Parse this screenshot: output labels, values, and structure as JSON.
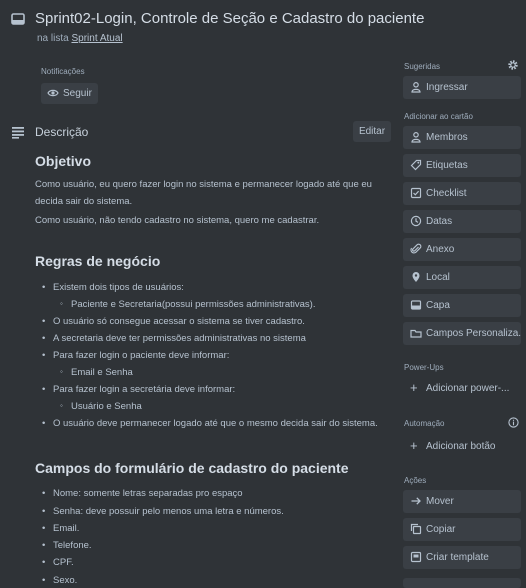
{
  "card": {
    "title": "Sprint02-Login, Controle de Seção e Cadastro do paciente",
    "list_prefix": "na lista",
    "list_name": "Sprint Atual"
  },
  "notifications": {
    "label": "Notificações",
    "follow": "Seguir"
  },
  "description": {
    "label": "Descrição",
    "edit": "Editar",
    "objective_title": "Objetivo",
    "objective_p1": "Como usuário, eu quero fazer login no sistema e permanecer logado até que eu decida sair do sistema.",
    "objective_p2": "Como usuário, não tendo cadastro no sistema, quero me cadastrar.",
    "rules_title": "Regras de negócio",
    "rules": [
      {
        "level": 1,
        "text": "Existem dois tipos de usuários:"
      },
      {
        "level": 2,
        "text": "Paciente e Secretaria(possui permissões administrativas)."
      },
      {
        "level": 1,
        "text": "O usuário só consegue acessar o sistema se tiver cadastro."
      },
      {
        "level": 1,
        "text": "A secretaria deve ter permissões administrativas no sistema"
      },
      {
        "level": 1,
        "text": "Para fazer login o paciente deve informar:"
      },
      {
        "level": 2,
        "text": "Email e Senha"
      },
      {
        "level": 1,
        "text": "Para fazer login a secretária deve informar:"
      },
      {
        "level": 2,
        "text": "Usuário e Senha"
      },
      {
        "level": 1,
        "text": "O usuário deve permanecer logado até que o mesmo decida sair do sistema."
      }
    ],
    "form_title": "Campos do formulário de cadastro do paciente",
    "form_fields": [
      "Nome: somente letras separadas pro espaço",
      "Senha: deve possuir pelo menos uma letra e números.",
      "Email.",
      "Telefone.",
      "CPF.",
      "Sexo."
    ]
  },
  "sidebar": {
    "suggested_label": "Sugeridas",
    "join": "Ingressar",
    "add_to_card_label": "Adicionar ao cartão",
    "add_items": [
      {
        "label": "Membros",
        "icon": "person-icon"
      },
      {
        "label": "Etiquetas",
        "icon": "tag-icon"
      },
      {
        "label": "Checklist",
        "icon": "checklist-icon"
      },
      {
        "label": "Datas",
        "icon": "clock-icon"
      },
      {
        "label": "Anexo",
        "icon": "paperclip-icon"
      },
      {
        "label": "Local",
        "icon": "location-pin-icon"
      },
      {
        "label": "Capa",
        "icon": "cover-icon"
      },
      {
        "label": "Campos Personaliza...",
        "icon": "custom-fields-icon"
      }
    ],
    "powerups_label": "Power-Ups",
    "add_powerup": "Adicionar power-...",
    "automation_label": "Automação",
    "add_button": "Adicionar botão",
    "actions_label": "Ações",
    "actions": [
      {
        "label": "Mover",
        "icon": "arrow-right-icon"
      },
      {
        "label": "Copiar",
        "icon": "copy-icon"
      },
      {
        "label": "Criar template",
        "icon": "template-icon"
      }
    ]
  }
}
